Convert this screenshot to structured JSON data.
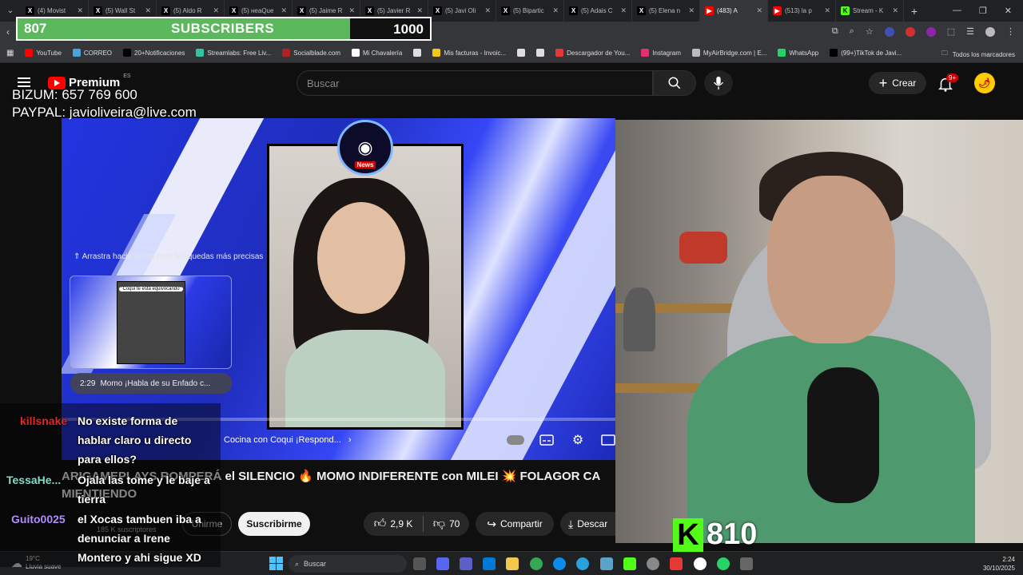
{
  "browser": {
    "tabs": [
      {
        "label": "(4) Movist",
        "icon": "x-icon",
        "color": "#000000"
      },
      {
        "label": "(5) Wall St",
        "icon": "x-icon",
        "color": "#000000"
      },
      {
        "label": "(5) Aldo R",
        "icon": "x-icon",
        "color": "#000000"
      },
      {
        "label": "(5) нeaQue",
        "icon": "x-icon",
        "color": "#000000"
      },
      {
        "label": "(5) Jaime R",
        "icon": "x-icon",
        "color": "#000000"
      },
      {
        "label": "(5) Javier R",
        "icon": "x-icon",
        "color": "#000000"
      },
      {
        "label": "(5) Javi Oli",
        "icon": "x-icon",
        "color": "#000000"
      },
      {
        "label": "(5) Bipartic",
        "icon": "x-icon",
        "color": "#000000"
      },
      {
        "label": "(5) Adais C",
        "icon": "x-icon",
        "color": "#000000"
      },
      {
        "label": "(5) Elena n",
        "icon": "x-icon",
        "color": "#000000"
      },
      {
        "label": "(483) A",
        "icon": "youtube-icon",
        "color": "#ff0000"
      },
      {
        "label": "(513) la p",
        "icon": "youtube-icon",
        "color": "#ff0000"
      },
      {
        "label": "Stream - K",
        "icon": "kick-icon",
        "color": "#53fc18"
      }
    ],
    "bookmarks": [
      {
        "label": "YouTube",
        "color": "#ff0000"
      },
      {
        "label": "CORREO",
        "color": "#4aa3df"
      },
      {
        "label": "20+Notificaciones",
        "color": "#000000"
      },
      {
        "label": "Streamlabs: Free Liv...",
        "color": "#31c3a2"
      },
      {
        "label": "Socialblade.com",
        "color": "#b22222"
      },
      {
        "label": "Mi Chavalería",
        "color": "#ffffff"
      },
      {
        "label": "",
        "color": "#dddddd"
      },
      {
        "label": "Mis facturas - Invoic...",
        "color": "#f5c518"
      },
      {
        "label": "",
        "color": "#dddddd"
      },
      {
        "label": "",
        "color": "#dddddd"
      },
      {
        "label": "Descargador de You...",
        "color": "#e53935"
      },
      {
        "label": "Instagram",
        "color": "#e1306c"
      },
      {
        "label": "MyAirBridge.com | E...",
        "color": "#bbbbbb"
      },
      {
        "label": "WhatsApp",
        "color": "#25d366"
      },
      {
        "label": "(99+)TikTok de Javi...",
        "color": "#000000"
      }
    ],
    "all_bookmarks_label": "Todos los marcadores"
  },
  "sub_goal": {
    "current": "807",
    "title": "SUBSCRIBERS",
    "goal": "1000",
    "progress": 0.807,
    "fill_color": "#5cb85c"
  },
  "donation": {
    "line1": "BIZUM: 657 769 600",
    "line2": "PAYPAL: javioliveira@live.com"
  },
  "youtube": {
    "logo_text": "Premium",
    "logo_region": "ES",
    "search_placeholder": "Buscar",
    "create_label": "Crear",
    "notif_badge": "9+"
  },
  "player": {
    "drag_hint": "⇑ Arrastra hacia arriba para búsquedas más precisas",
    "card_timestamp": "2:29",
    "card_title": "Momo ¡Habla de su Enfado c...",
    "chapter_label": "Cocina con Coqui ¡Respond...",
    "card_caption": "\"Coqui te esta equivocando\"",
    "logo_badge": "News"
  },
  "video": {
    "title": "ARIGAMEPLAYS ROMPERÁ el SILENCIO 🔥 MOMO INDIFERENTE con MILEI 💥 FOLAGOR CA",
    "title2": "MIENTIENDO",
    "subscribers": "185 K suscriptores",
    "join_label": "Unirme",
    "subscribe_label": "Suscribirme",
    "likes": "2,9 K",
    "dislikes": "70",
    "share_label": "Compartir",
    "download_label": "Descar"
  },
  "kick_followers": {
    "count": "810",
    "color": "#53fc18"
  },
  "chat": [
    {
      "user": "killsnake",
      "color": "#e02828",
      "text": "No existe forma de hablar claro u directo para ellos?"
    },
    {
      "user": "TessaHe...",
      "color": "#7ee0c8",
      "text": "Ojala las tome y le baje a tierra"
    },
    {
      "user": "Guito0025",
      "color": "#b58cff",
      "text": "el Xocas tambuen iba a denunciar a Irene Montero y ahi sigue XD"
    }
  ],
  "taskbar": {
    "temp": "19°C",
    "weather": "Lluvia suave",
    "search": "Buscar",
    "time": "2:24",
    "date": "30/10/2025"
  }
}
